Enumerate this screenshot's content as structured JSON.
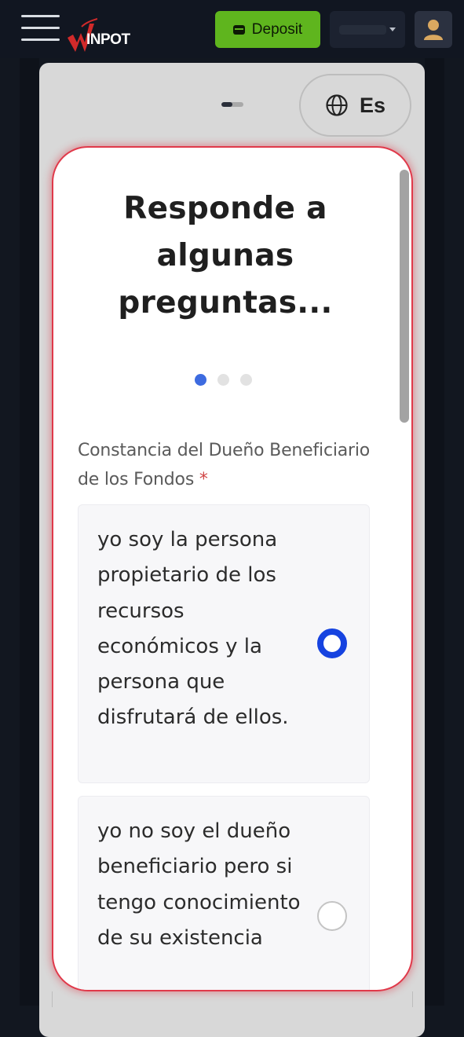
{
  "header": {
    "logo_text": "INPOT",
    "deposit_label": "Deposit",
    "colors": {
      "deposit_bg": "#5fb51e",
      "logo_red": "#d12a2a"
    }
  },
  "onboarding": {
    "progress_fraction": 0.5,
    "language_label": "Es"
  },
  "modal": {
    "title": "Responde a algunas preguntas...",
    "step_dots": {
      "total": 3,
      "active": 1
    },
    "question_label": "Constancia del Dueño Beneficiario de los Fondos",
    "required_mark": "*",
    "options": [
      {
        "label": "yo soy la persona propietario de los recursos económicos y la persona que disfrutará de ellos.",
        "selected": true
      },
      {
        "label": "yo no soy el dueño beneficiario pero si tengo conocimiento de su existencia",
        "selected": false
      }
    ],
    "colors": {
      "border": "#e0394a",
      "accent": "#1643e0"
    }
  }
}
